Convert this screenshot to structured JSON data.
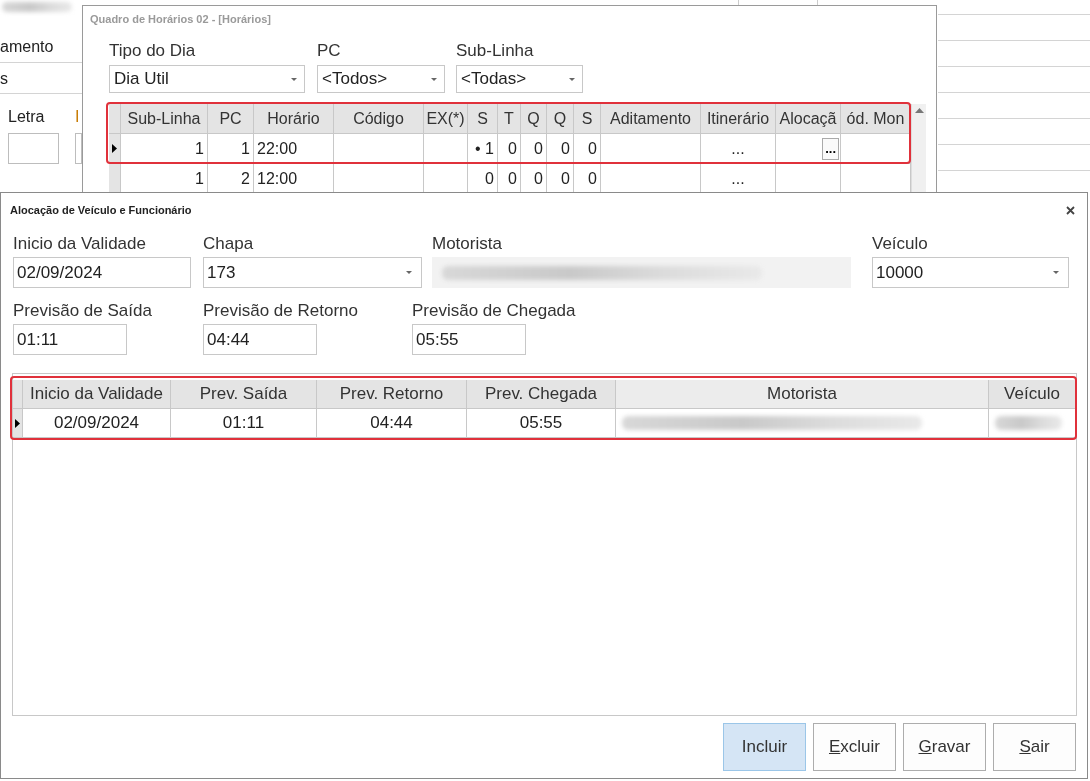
{
  "background_window": {
    "field_label": "amento",
    "field_value": "s",
    "letter_label": "Letra",
    "cut_label": "I"
  },
  "schedule_window": {
    "title": "Quadro de Horários 02 - [Horários]",
    "active": false,
    "filters": [
      {
        "label": "Tipo do Dia",
        "value": "Dia Util"
      },
      {
        "label": "PC",
        "value": "<Todos>"
      },
      {
        "label": "Sub-Linha",
        "value": "<Todas>"
      }
    ],
    "grid": {
      "highlighted": true,
      "columns": [
        "Sub-Linha",
        "PC",
        "Horário",
        "Código",
        "EX(*)",
        "S",
        "T",
        "Q",
        "Q",
        "S",
        "Aditamento",
        "Itinerário",
        "Alocaçã",
        "ód. Mon"
      ],
      "rows": [
        {
          "current": true,
          "cells": [
            "1",
            "1",
            "22:00",
            null,
            null,
            "• 1",
            "0",
            "0",
            "0",
            "0",
            null,
            "...",
            {
              "kind": "button",
              "text": "..."
            },
            null
          ]
        },
        {
          "current": false,
          "cells": [
            "1",
            "2",
            "12:00",
            null,
            null,
            "0",
            "0",
            "0",
            "0",
            "0",
            null,
            "...",
            null,
            null
          ]
        }
      ]
    }
  },
  "allocation_dialog": {
    "title": "Alocação de Veículo e Funcionário",
    "fields": [
      {
        "label": "Inicio da Validade",
        "value": "02/09/2024",
        "kind": "text"
      },
      {
        "label": "Chapa",
        "value": "173",
        "kind": "combo"
      },
      {
        "label": "Motorista",
        "kind": "redacted"
      },
      {
        "label": "Veículo",
        "value": "10000",
        "kind": "combo"
      },
      {
        "label": "Previsão de Saída",
        "value": "01:11",
        "kind": "text"
      },
      {
        "label": "Previsão de Retorno",
        "value": "04:44",
        "kind": "text"
      },
      {
        "label": "Previsão de Chegada",
        "value": "05:55",
        "kind": "text"
      }
    ],
    "grid": {
      "highlighted": true,
      "columns": [
        "Inicio da Validade",
        "Prev. Saída",
        "Prev. Retorno",
        "Prev. Chegada",
        "Motorista",
        "Veículo"
      ],
      "rows": [
        {
          "current": true,
          "cells": [
            "02/09/2024",
            "01:11",
            "04:44",
            "05:55",
            {
              "kind": "redacted"
            },
            {
              "kind": "redacted"
            }
          ]
        }
      ]
    },
    "buttons": [
      {
        "label": "Incluir",
        "hover": true,
        "mnemonic": false
      },
      {
        "label": "Excluir",
        "hover": false,
        "mnemonic": true
      },
      {
        "label": "Gravar",
        "hover": false,
        "mnemonic": true
      },
      {
        "label": "Sair",
        "hover": false,
        "mnemonic": true
      }
    ]
  }
}
